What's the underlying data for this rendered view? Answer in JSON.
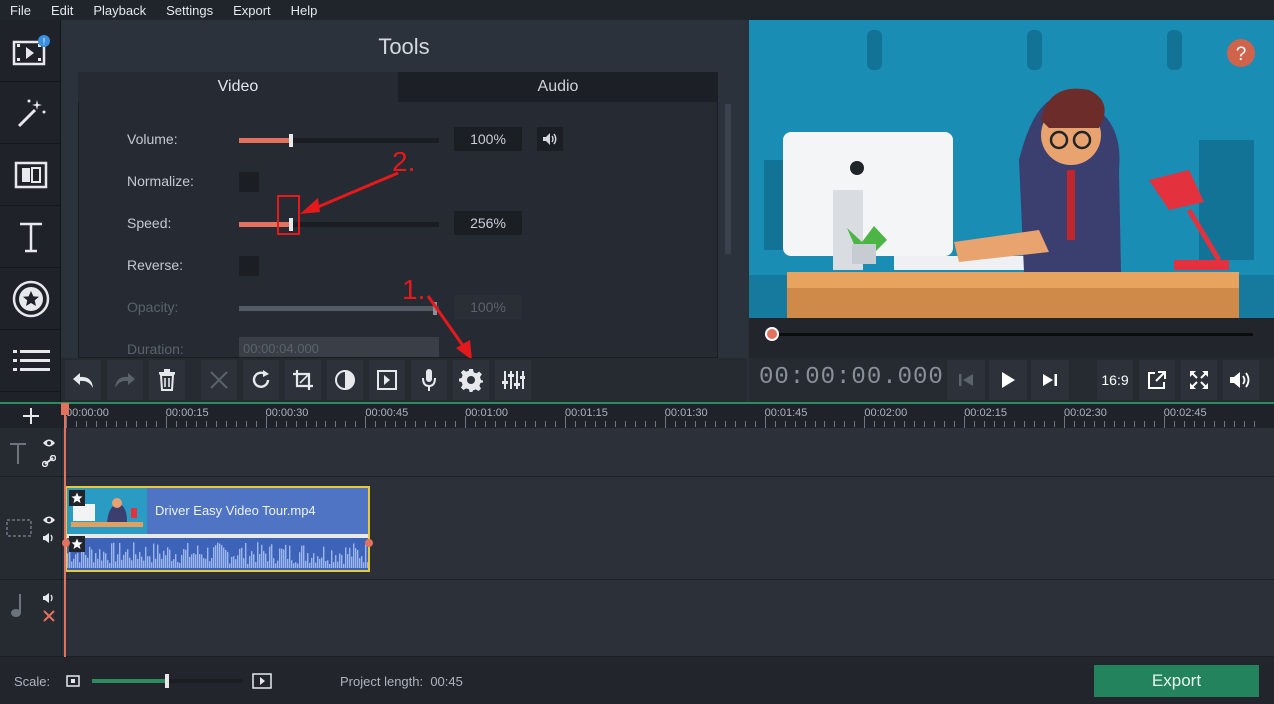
{
  "menu": [
    "File",
    "Edit",
    "Playback",
    "Settings",
    "Export",
    "Help"
  ],
  "tools": {
    "title": "Tools",
    "tabs": [
      "Video",
      "Audio"
    ],
    "rows": [
      {
        "label": "Volume:",
        "value": "100%",
        "fill": 0.26
      },
      {
        "label": "Normalize:"
      },
      {
        "label": "Speed:",
        "value": "256%",
        "fill": 0.26
      },
      {
        "label": "Reverse:"
      },
      {
        "label": "Opacity:",
        "value": "100%",
        "fill": 0.98
      },
      {
        "label": "Duration:",
        "value": "00:00:04.000"
      }
    ]
  },
  "annotations": {
    "one": "1.",
    "two": "2."
  },
  "player": {
    "timecode": "00:00:00.000",
    "aspect": "16:9",
    "progress": 0
  },
  "timeline": {
    "ticks": [
      "00:00:00",
      "00:00:15",
      "00:00:30",
      "00:00:45",
      "00:01:00",
      "00:01:15",
      "00:01:30",
      "00:01:45",
      "00:02:00",
      "00:02:15",
      "00:02:30",
      "00:02:45"
    ],
    "clip_name": "Driver Easy Video Tour.mp4"
  },
  "status": {
    "scale_label": "Scale:",
    "scale_value": 0.5,
    "project_length": "Project length:  00:45",
    "export_label": "Export"
  },
  "colors": {
    "accent": "#e2715e",
    "export": "#23835c",
    "annotation": "#e5191c"
  }
}
